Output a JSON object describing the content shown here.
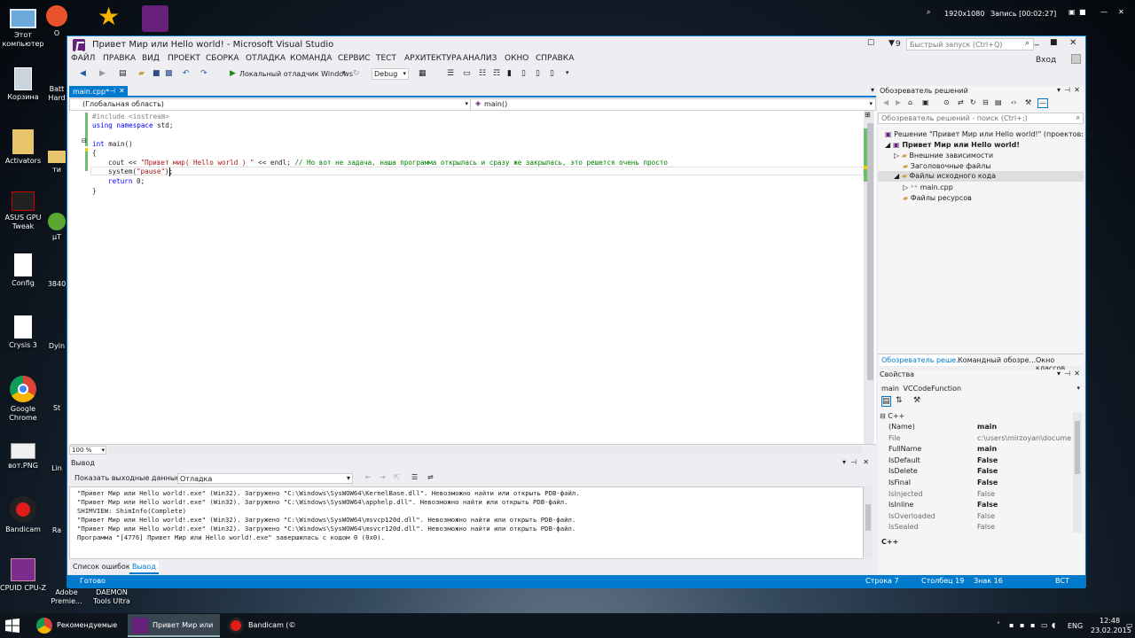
{
  "desktop": {
    "icons": [
      {
        "label": "Этот компьютер"
      },
      {
        "label": "Корзина"
      },
      {
        "label": "Activators"
      },
      {
        "label": "ASUS GPU Tweak"
      },
      {
        "label": "Config"
      },
      {
        "label": "Crysis 3"
      },
      {
        "label": "Google Chrome"
      },
      {
        "label": "вот.PNG"
      },
      {
        "label": "Bandicam"
      },
      {
        "label": "CPUID CPU-Z"
      },
      {
        "label": "Adobe Premie..."
      },
      {
        "label": "DAEMON Tools Ultra"
      }
    ],
    "partial_icons": [
      "О",
      "Batt Hard",
      "ти",
      "µT",
      "3840",
      "Dyin",
      "St",
      "Lin",
      "Ra"
    ],
    "recording": {
      "resolution": "1920x1080",
      "status": "Запись [00:02:27]"
    }
  },
  "window": {
    "title": "Привет Мир или Hello world! - Microsoft Visual Studio",
    "notification_count": "9",
    "quick_launch_placeholder": "Быстрый запуск (Ctrl+Q)",
    "sign_in": "Вход",
    "menu": [
      "ФАЙЛ",
      "ПРАВКА",
      "ВИД",
      "ПРОЕКТ",
      "СБОРКА",
      "ОТЛАДКА",
      "КОМАНДА",
      "СЕРВИС",
      "ТЕСТ",
      "АРХИТЕКТУРА",
      "АНАЛИЗ",
      "ОКНО",
      "СПРАВКА"
    ],
    "toolbar": {
      "debugger": "Локальный отладчик Windows",
      "config": "Debug"
    }
  },
  "editor": {
    "tab": "main.cpp*",
    "scope": "(Глобальная область)",
    "member": "main()",
    "zoom": "100 %",
    "lines": [
      {
        "indent": 0,
        "parts": [
          {
            "t": "#include <iostream>",
            "c": "pp"
          }
        ]
      },
      {
        "indent": 0,
        "parts": [
          {
            "t": "using namespace",
            "c": "kw"
          },
          {
            "t": " std;",
            "c": ""
          }
        ]
      },
      {
        "indent": 0,
        "parts": []
      },
      {
        "indent": 0,
        "parts": [
          {
            "t": "int",
            "c": "kw"
          },
          {
            "t": " main()",
            "c": ""
          }
        ]
      },
      {
        "indent": 0,
        "parts": [
          {
            "t": "{",
            "c": ""
          }
        ]
      },
      {
        "indent": 1,
        "parts": [
          {
            "t": "cout << ",
            "c": ""
          },
          {
            "t": "\"Привет мир( Hello world ) \"",
            "c": "st"
          },
          {
            "t": " << endl; ",
            "c": ""
          },
          {
            "t": "// Но вот не задача, наша программа открылась и сразу же закрылась, это решется очень просто",
            "c": "cm"
          }
        ]
      },
      {
        "indent": 1,
        "parts": [
          {
            "t": "system(",
            "c": ""
          },
          {
            "t": "\"pause\"",
            "c": "st"
          },
          {
            "t": ");",
            "c": ""
          }
        ]
      },
      {
        "indent": 1,
        "parts": [
          {
            "t": "return",
            "c": "kw"
          },
          {
            "t": " 0;",
            "c": ""
          }
        ]
      },
      {
        "indent": 0,
        "parts": [
          {
            "t": "}",
            "c": ""
          }
        ]
      }
    ]
  },
  "output": {
    "title": "Вывод",
    "source_label": "Показать выходные данные от:",
    "source_value": "Отладка",
    "lines": [
      "\"Привет Мир или Hello world!.exe\" (Win32). Загружено \"C:\\Windows\\SysWOW64\\KernelBase.dll\". Невозможно найти или открыть PDB-файл.",
      "\"Привет Мир или Hello world!.exe\" (Win32). Загружено \"C:\\Windows\\SysWOW64\\apphelp.dll\". Невозможно найти или открыть PDB-файл.",
      "SHIMVIEW: ShimInfo(Complete)",
      "\"Привет Мир или Hello world!.exe\" (Win32). Загружено \"C:\\Windows\\SysWOW64\\msvcp120d.dll\". Невозможно найти или открыть PDB-файл.",
      "\"Привет Мир или Hello world!.exe\" (Win32). Загружено \"C:\\Windows\\SysWOW64\\msvcr120d.dll\". Невозможно найти или открыть PDB-файл.",
      "Программа \"[4776] Привет Мир или Hello world!.exe\" завершилась с кодом 0 (0x0)."
    ],
    "tabs": [
      "Список ошибок",
      "Вывод"
    ]
  },
  "solution_explorer": {
    "title": "Обозреватель решений",
    "search_placeholder": "Обозреватель решений - поиск (Ctrl+;)",
    "items": [
      {
        "label": "Решение \"Привет Мир или Hello world!\"  (проектов: 1)",
        "bold": false
      },
      {
        "label": "Привет Мир или Hello world!",
        "bold": true
      },
      {
        "label": "Внешние зависимости",
        "bold": false
      },
      {
        "label": "Заголовочные файлы",
        "bold": false
      },
      {
        "label": "Файлы исходного кода",
        "bold": false
      },
      {
        "label": "main.cpp",
        "bold": false
      },
      {
        "label": "Файлы ресурсов",
        "bold": false
      }
    ],
    "tabs": [
      "Обозреватель реше...",
      "Командный обозре...",
      "Окно классов"
    ]
  },
  "properties": {
    "title": "Свойства",
    "object": "main",
    "object_type": "VCCodeFunction",
    "category": "C++",
    "rows": [
      {
        "name": "(Name)",
        "value": "main"
      },
      {
        "name": "File",
        "value": "c:\\users\\mirzoyan\\documen"
      },
      {
        "name": "FullName",
        "value": "main"
      },
      {
        "name": "IsDefault",
        "value": "False"
      },
      {
        "name": "IsDelete",
        "value": "False"
      },
      {
        "name": "IsFinal",
        "value": "False"
      },
      {
        "name": "IsInjected",
        "value": "False"
      },
      {
        "name": "IsInline",
        "value": "False"
      },
      {
        "name": "IsOverloaded",
        "value": "False"
      },
      {
        "name": "IsSealed",
        "value": "False"
      }
    ],
    "footer": "C++"
  },
  "statusbar": {
    "ready": "Готово",
    "line": "Строка 7",
    "col": "Столбец 19",
    "ch": "Знак 16",
    "mode": "ВСТ"
  },
  "taskbar": {
    "items": [
      "Рекомендуемые ...",
      "Привет Мир или ...",
      "Bandicam (© Ban..."
    ],
    "lang": "ENG",
    "time": "12:48",
    "date": "23.02.2015"
  },
  "colors": {
    "accent": "#007acc",
    "vs_purple": "#68217a"
  }
}
